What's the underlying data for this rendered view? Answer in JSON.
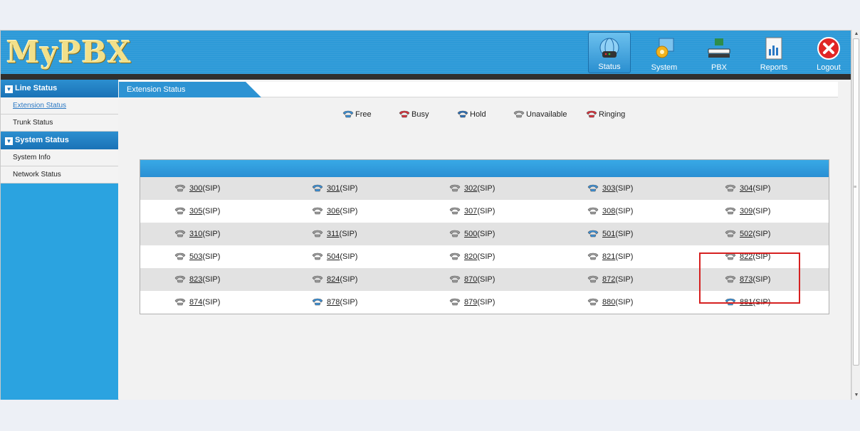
{
  "header": {
    "logo": "MyPBX",
    "nav": [
      {
        "label": "Status",
        "icon": "status-globe-icon",
        "active": true
      },
      {
        "label": "System",
        "icon": "system-gear-icon",
        "active": false
      },
      {
        "label": "PBX",
        "icon": "pbx-device-icon",
        "active": false
      },
      {
        "label": "Reports",
        "icon": "reports-chart-icon",
        "active": false
      },
      {
        "label": "Logout",
        "icon": "logout-close-icon",
        "active": false
      }
    ]
  },
  "sidebar": {
    "sections": [
      {
        "title": "Line Status",
        "items": [
          {
            "label": "Extension Status",
            "active": true
          },
          {
            "label": "Trunk Status",
            "active": false
          }
        ]
      },
      {
        "title": "System Status",
        "items": [
          {
            "label": "System Info",
            "active": false
          },
          {
            "label": "Network Status",
            "active": false
          }
        ]
      }
    ]
  },
  "main": {
    "tab": "Extension Status",
    "legend": [
      {
        "label": "Free",
        "status": "free",
        "color": "#3a8fd6"
      },
      {
        "label": "Busy",
        "status": "busy",
        "color": "#d8303a"
      },
      {
        "label": "Hold",
        "status": "hold",
        "color": "#2a6fb8"
      },
      {
        "label": "Unavailable",
        "status": "unavailable",
        "color": "#9a9a9a"
      },
      {
        "label": "Ringing",
        "status": "ringing",
        "color": "#d8303a"
      }
    ],
    "rows": [
      [
        {
          "num": "300",
          "type": "(SIP)",
          "status": "unavailable"
        },
        {
          "num": "301",
          "type": "(SIP)",
          "status": "free"
        },
        {
          "num": "302",
          "type": "(SIP)",
          "status": "unavailable"
        },
        {
          "num": "303",
          "type": "(SIP)",
          "status": "free"
        },
        {
          "num": "304",
          "type": "(SIP)",
          "status": "unavailable"
        }
      ],
      [
        {
          "num": "305",
          "type": "(SIP)",
          "status": "unavailable"
        },
        {
          "num": "306",
          "type": "(SIP)",
          "status": "unavailable"
        },
        {
          "num": "307",
          "type": "(SIP)",
          "status": "unavailable"
        },
        {
          "num": "308",
          "type": "(SIP)",
          "status": "unavailable"
        },
        {
          "num": "309",
          "type": "(SIP)",
          "status": "unavailable"
        }
      ],
      [
        {
          "num": "310",
          "type": "(SIP)",
          "status": "unavailable"
        },
        {
          "num": "311",
          "type": "(SIP)",
          "status": "unavailable"
        },
        {
          "num": "500",
          "type": "(SIP)",
          "status": "unavailable"
        },
        {
          "num": "501",
          "type": "(SIP)",
          "status": "free"
        },
        {
          "num": "502",
          "type": "(SIP)",
          "status": "unavailable"
        }
      ],
      [
        {
          "num": "503",
          "type": "(SIP)",
          "status": "unavailable"
        },
        {
          "num": "504",
          "type": "(SIP)",
          "status": "unavailable"
        },
        {
          "num": "820",
          "type": "(SIP)",
          "status": "unavailable"
        },
        {
          "num": "821",
          "type": "(SIP)",
          "status": "unavailable"
        },
        {
          "num": "822",
          "type": "(SIP)",
          "status": "unavailable"
        }
      ],
      [
        {
          "num": "823",
          "type": "(SIP)",
          "status": "unavailable"
        },
        {
          "num": "824",
          "type": "(SIP)",
          "status": "unavailable"
        },
        {
          "num": "870",
          "type": "(SIP)",
          "status": "unavailable"
        },
        {
          "num": "872",
          "type": "(SIP)",
          "status": "unavailable"
        },
        {
          "num": "873",
          "type": "(SIP)",
          "status": "unavailable"
        }
      ],
      [
        {
          "num": "874",
          "type": "(SIP)",
          "status": "unavailable"
        },
        {
          "num": "878",
          "type": "(SIP)",
          "status": "free"
        },
        {
          "num": "879",
          "type": "(SIP)",
          "status": "unavailable"
        },
        {
          "num": "880",
          "type": "(SIP)",
          "status": "unavailable"
        },
        {
          "num": "881",
          "type": "(SIP)",
          "status": "free"
        }
      ]
    ]
  },
  "annotation": {
    "color": "#d62020"
  }
}
